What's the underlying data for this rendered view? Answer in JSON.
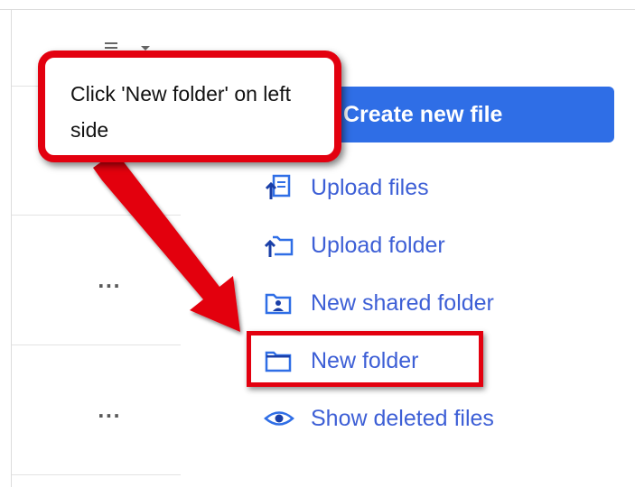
{
  "callout": {
    "text": "Click 'New folder' on left side"
  },
  "create_button": {
    "label": "Create new file"
  },
  "actions": [
    {
      "label": "Upload files",
      "icon": "upload-files-icon"
    },
    {
      "label": "Upload folder",
      "icon": "upload-folder-icon"
    },
    {
      "label": "New shared folder",
      "icon": "shared-folder-icon"
    },
    {
      "label": "New folder",
      "icon": "folder-icon"
    },
    {
      "label": "Show deleted files",
      "icon": "eye-icon"
    }
  ],
  "row_menu": {
    "label": "..."
  },
  "colors": {
    "accent": "#2f6ee6",
    "link": "#3d5fd6",
    "annotation": "#e3000f"
  }
}
